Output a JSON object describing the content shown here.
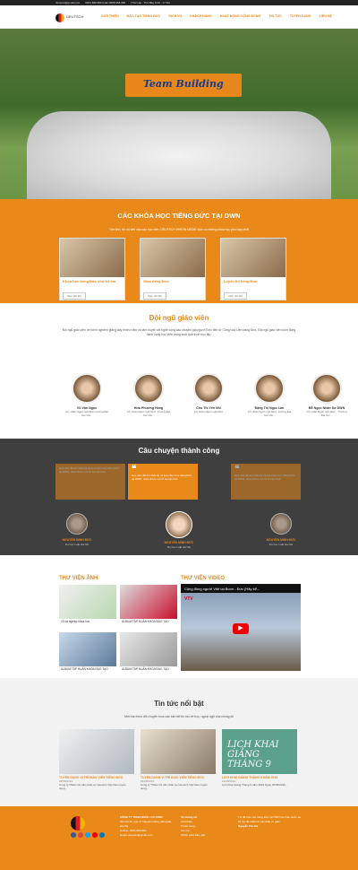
{
  "topbar": {
    "email": "dwnedu@gmail.com",
    "hotline": "0901.898.880 hoặc 0988.968.086",
    "hours": "(Thứ Hai - Thứ Bảy 8:30 - 17:30)"
  },
  "header": {
    "logo_text": "DEUTSCH",
    "nav": [
      "GIỚI THIỆU",
      "ĐÀO TẠO TIẾNG ĐỨC",
      "DỊCH VỤ",
      "KHÁCH HÀNG",
      "HOẠT ĐỘNG CỘNG ĐỒNG",
      "TIN TỨC",
      "TUYỂN DỤNG",
      "LIÊN HỆ"
    ]
  },
  "hero": {
    "banner": "Team Building"
  },
  "courses": {
    "title": "CÁC KHÓA HỌC TIẾNG ĐỨC TẠI DWN",
    "subtitle": "Tận tình, tôi ưu tiên cầu các học viên, DEUTSCH WHEIN MEDIE luôn có những khóa học phù hợp nhất",
    "items": [
      {
        "name": "Khóa học tiếng Đức cho trẻ em",
        "btn": "Xem chi tiết"
      },
      {
        "name": "Giao tiếng Đức",
        "btn": "Xem chi tiết"
      },
      {
        "name": "Luyện thi tiếng Đức",
        "btn": "Xem chi tiết"
      }
    ],
    "colors": {
      "accent": "#e8891a"
    }
  },
  "teachers": {
    "title": "Đội ngũ giáo viên",
    "intro": "Đội ngũ giáo viên với kinh nghiệm giảng dạy nhiều năm và tâm huyết với nghề cùng các chuyên gia người Đức đến từ Cộng hòa Liên bang Đức. Đội ngũ giáo viên luôn đồng hành cùng học viên trong suốt quá trình học tập.",
    "items": [
      {
        "name": "Vũ Văn Ngọc",
        "desc": "Cử nhân Ngôn ngữ Đức trường Đại học Hà..."
      },
      {
        "name": "Hứa Phương Hồng",
        "desc": "Cử nhân Ngôn ngữ Đức, trường Đại học Hà..."
      },
      {
        "name": "Chu Thị Yến Nhi",
        "desc": "Cử nhân Ngôn ngữ Đức"
      },
      {
        "name": "Đặng Thị Ngọc Lan",
        "desc": "Cử nhân Ngôn ngữ Đức, trường Đại học Hà..."
      },
      {
        "name": "Đỗ Ngọc Nhân Sự DWN",
        "desc": "Cử nhân Ngôn ngữ Đức - Trường Đại học..."
      }
    ]
  },
  "stories": {
    "title": "Câu chuyện thành công",
    "items": [
      {
        "text": "Học viên đã tìm hiểu kỹ và lựa chọn học tiếng Đức tại DWN, nhận được sự hỗ trợ tận tình.",
        "name": "NGUYỄN MINH ĐỨC",
        "role": "Du học Luật Hà Nội"
      },
      {
        "text": "Học viên đã tìm hiểu kỹ và lựa chọn học tiếng Đức tại DWN, nhận được sự hỗ trợ tận tình.",
        "name": "NGUYỄN MINH ĐỨC",
        "role": "Du học Luật Hà Nội"
      },
      {
        "text": "Học viên đã tìm hiểu kỹ và lựa chọn học tiếng Đức tại DWN, nhận được sự hỗ trợ tận tình.",
        "name": "NGUYỄN MINH ĐỨC",
        "role": "Du học Luật Hà Nội"
      }
    ]
  },
  "library": {
    "photos_title": "THƯ VIỆN ẢNH",
    "video_title": "THƯ VIỆN VIDEO",
    "photos": [
      {
        "cap": "Lễ tốt nghiệp khóa học"
      },
      {
        "cap": "ALBUM TẬP HUẤN KHÓA ĐÀO TẠO"
      },
      {
        "cap": "ALBUM TẬP HUẤN KHÓA ĐÀO TẠO"
      },
      {
        "cap": "ALBUM TẬP HUẤN KHÓA ĐÀO TẠO"
      }
    ],
    "video": {
      "title": "Cộng đồng người Việt tại Bonn - Đức [Hãy kể...",
      "channel": "VTV"
    }
  },
  "news": {
    "title": "Tin tức nổi bật",
    "subtitle": "Mời bạn theo dõi chuyên mục các bài viết tin tức về học, ngoại ngữ của chúng tôi",
    "items": [
      {
        "title": "TUYỂN DỤNG VỊ TRÍ GIÁO VIÊN TIẾNG ĐỨC",
        "date": "24/08/2019",
        "excerpt": "Công ty TNHH Cổ vấn nhân sự Deutsch Việt Nam tuyển dụng..."
      },
      {
        "title": "TUYỂN DỤNG VỊ TRÍ GIÁO VIÊN TIẾNG ĐỨC",
        "date": "24/08/2019",
        "excerpt": "Công ty TNHH Cổ vấn nhân sự Deutsch Việt Nam tuyển dụng..."
      },
      {
        "title": "LỊCH KHAI GIẢNG THÁNG 9 NĂM 2019",
        "date": "24/08/2019",
        "excerpt": "Lịch Khai Giảng Tháng 9 năm 2019 Ngày 26/08/2019...",
        "img_text": "LỊCH KHAI GIẢNG THÁNG 9"
      }
    ]
  },
  "footer": {
    "company": "CÔNG TY TNHH NHÂN LỰC DWN",
    "address": "Số nhà 15, ngõ 47 Nguyên Hồng, Đống Đa, Hà Nội",
    "phone": "Hotline: 0901.898.880",
    "email": "Email: dwnedu@gmail.com",
    "col2_title": "Về chúng tôi",
    "col2_items": [
      "Giới thiệu",
      "Tuyển dụng",
      "Liên hệ",
      "Chính sách bảo mật"
    ],
    "testimonial": "Tôi đã theo học tiếng Đức tại DWN và nhận được sự hỗ trợ rất nhiều từ các thầy cô giáo.",
    "testimonial_name": "Nguyễn Thu Hà"
  }
}
